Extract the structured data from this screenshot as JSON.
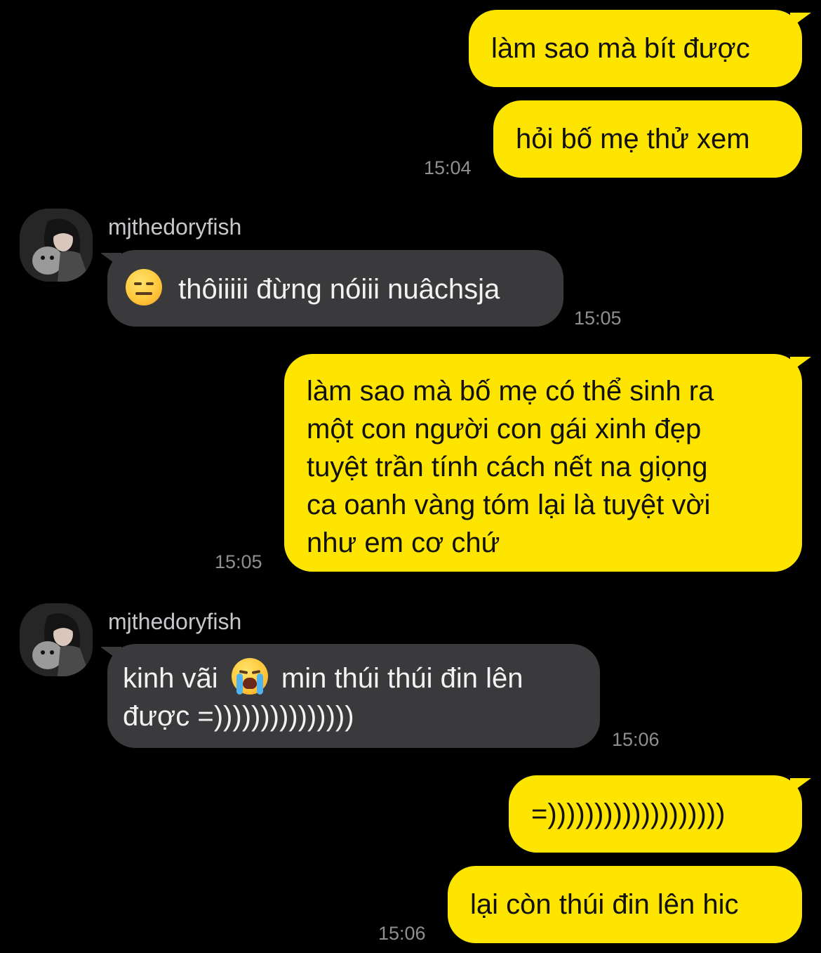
{
  "contact": {
    "name": "mjthedoryfish"
  },
  "messages": {
    "m1": {
      "text": "làm sao mà bít được"
    },
    "m2": {
      "text": "hỏi bố mẹ thử xem",
      "time": "15:04"
    },
    "m3": {
      "emoji": "expressionless-face",
      "text": "thôiiiii đừng nóiii nuâchsja",
      "time": "15:05"
    },
    "m4": {
      "lines": [
        "làm sao mà bố mẹ có thể sinh ra",
        "một con người con gái xinh đẹp",
        "tuyệt trần tính cách nết na giọng",
        "ca oanh vàng tóm lại là tuyệt vời",
        "như em cơ chứ"
      ],
      "time": "15:05"
    },
    "m5": {
      "line1_before": "kinh vãi",
      "emoji": "loudly-crying-face",
      "line1_after": "min thúi thúi đin lên",
      "line2": "được =)))))))))))))))",
      "time": "15:06"
    },
    "m6": {
      "text": "=)))))))))))))))))))"
    },
    "m7": {
      "text": "lại còn thúi đin lên hic",
      "time": "15:06"
    }
  },
  "colors": {
    "background": "#000000",
    "my_bubble": "#FEE500",
    "their_bubble": "#3A3A3C",
    "timestamp": "#8E8E93"
  }
}
